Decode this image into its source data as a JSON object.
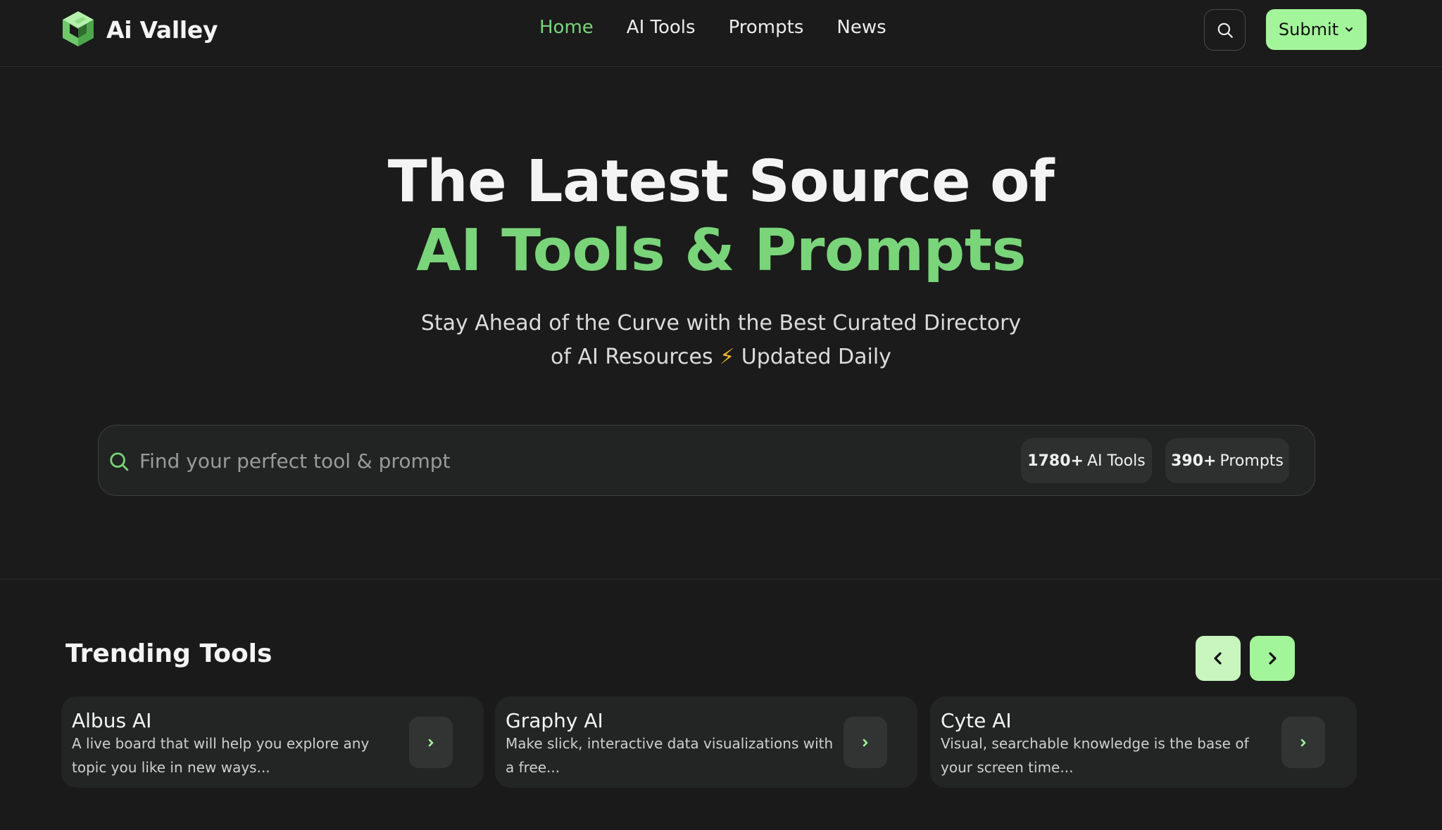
{
  "header": {
    "brand": "Ai Valley",
    "nav": [
      {
        "label": "Home",
        "active": true
      },
      {
        "label": "AI Tools",
        "active": false
      },
      {
        "label": "Prompts",
        "active": false
      },
      {
        "label": "News",
        "active": false
      }
    ],
    "search_icon": "search-icon",
    "submit_label": "Submit",
    "submit_icon": "chevron-down-icon"
  },
  "hero": {
    "title_line1": "The Latest Source of",
    "title_line2": "AI Tools & Prompts",
    "subtitle_line1": "Stay Ahead of the Curve with the Best Curated Directory",
    "subtitle_line2_pre": "of AI Resources",
    "subtitle_line2_icon": "⚡",
    "subtitle_line2_post": "Updated Daily"
  },
  "search": {
    "placeholder": "Find your perfect tool & prompt",
    "value": "",
    "tools_count": "1780+",
    "tools_label": "AI Tools",
    "prompts_count": "390+",
    "prompts_label": "Prompts"
  },
  "trending": {
    "title": "Trending Tools",
    "prev_icon": "chevron-left-icon",
    "next_icon": "chevron-right-icon",
    "cards": [
      {
        "title": "Albus AI",
        "description": "A live board that will help you explore any topic you like in new ways..."
      },
      {
        "title": "Graphy AI",
        "description": "Make slick, interactive data visualizations with a free..."
      },
      {
        "title": "Cyte AI",
        "description": "Visual, searchable knowledge is the base of your screen time..."
      }
    ]
  },
  "colors": {
    "accent": "#7ad47a",
    "button": "#a3f59a",
    "background": "#1b1b1b",
    "card": "#232424"
  }
}
